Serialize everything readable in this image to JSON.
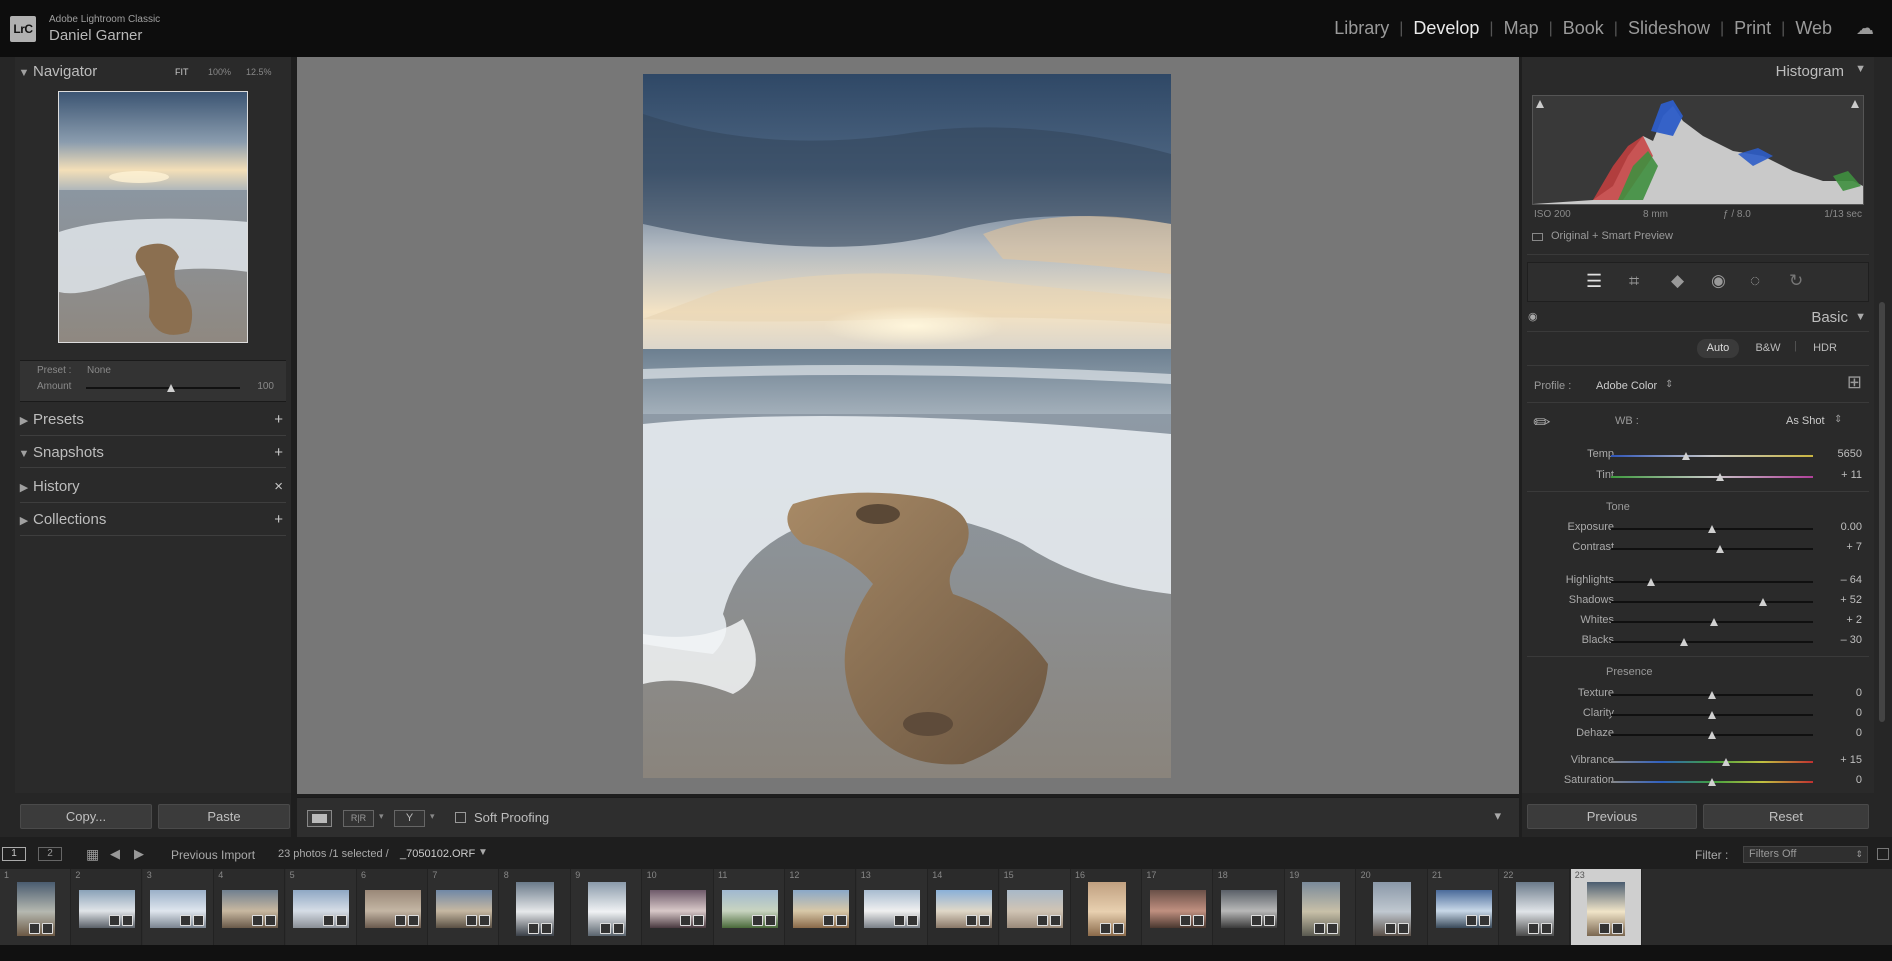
{
  "app": {
    "subtitle": "Adobe Lightroom Classic",
    "user": "Daniel Garner",
    "logo": "LrC"
  },
  "modules": [
    {
      "label": "Library",
      "active": false
    },
    {
      "label": "Develop",
      "active": true
    },
    {
      "label": "Map",
      "active": false
    },
    {
      "label": "Book",
      "active": false
    },
    {
      "label": "Slideshow",
      "active": false
    },
    {
      "label": "Print",
      "active": false
    },
    {
      "label": "Web",
      "active": false
    }
  ],
  "left": {
    "navigator": {
      "title": "Navigator",
      "fit": "FIT",
      "z100": "100%",
      "z125": "12.5%"
    },
    "preset": {
      "label": "Preset :",
      "value": "None",
      "amount_label": "Amount",
      "amount_value": "100",
      "amount_level": 0.55
    },
    "panels": [
      {
        "title": "Presets",
        "icon": "+"
      },
      {
        "title": "Snapshots",
        "icon": "+"
      },
      {
        "title": "History",
        "icon": "×"
      },
      {
        "title": "Collections",
        "icon": "+"
      }
    ],
    "copy": "Copy...",
    "paste": "Paste"
  },
  "toolbar": {
    "soft_proofing": "Soft Proofing"
  },
  "right": {
    "histogram": {
      "title": "Histogram",
      "iso": "ISO 200",
      "focal": "8 mm",
      "aperture": "ƒ / 8.0",
      "shutter": "1/13 sec",
      "preview": "Original + Smart Preview"
    },
    "basic": {
      "title": "Basic",
      "auto": "Auto",
      "bw": "B&W",
      "hdr": "HDR",
      "profile_label": "Profile :",
      "profile_value": "Adobe Color",
      "wb_label": "WB :",
      "wb_value": "As Shot",
      "tone": "Tone",
      "presence": "Presence"
    },
    "sliders": [
      {
        "label": "Temp",
        "value": "5650",
        "level": 0.37,
        "kind": "temp"
      },
      {
        "label": "Tint",
        "value": "+ 11",
        "level": 0.54,
        "kind": "tint"
      },
      {
        "label": "Exposure",
        "value": "0.00",
        "level": 0.5,
        "kind": "plain"
      },
      {
        "label": "Contrast",
        "value": "+ 7",
        "level": 0.54,
        "kind": "plain"
      },
      {
        "label": "Highlights",
        "value": "– 64",
        "level": 0.2,
        "kind": "plain"
      },
      {
        "label": "Shadows",
        "value": "+ 52",
        "level": 0.75,
        "kind": "plain"
      },
      {
        "label": "Whites",
        "value": "+ 2",
        "level": 0.51,
        "kind": "plain"
      },
      {
        "label": "Blacks",
        "value": "– 30",
        "level": 0.36,
        "kind": "plain"
      },
      {
        "label": "Texture",
        "value": "0",
        "level": 0.5,
        "kind": "plain"
      },
      {
        "label": "Clarity",
        "value": "0",
        "level": 0.5,
        "kind": "plain"
      },
      {
        "label": "Dehaze",
        "value": "0",
        "level": 0.5,
        "kind": "plain"
      },
      {
        "label": "Vibrance",
        "value": "+ 15",
        "level": 0.57,
        "kind": "vib"
      },
      {
        "label": "Saturation",
        "value": "0",
        "level": 0.5,
        "kind": "vib"
      }
    ],
    "previous": "Previous",
    "reset": "Reset"
  },
  "filmbar": {
    "screen1": "1",
    "screen2": "2",
    "source": "Previous Import",
    "count": "23 photos /1 selected /",
    "filename": "_7050102.ORF",
    "filter_label": "Filter :",
    "filter_value": "Filters Off"
  },
  "thumbs": [
    "1",
    "2",
    "3",
    "4",
    "5",
    "6",
    "7",
    "8",
    "9",
    "10",
    "11",
    "12",
    "13",
    "14",
    "15",
    "16",
    "17",
    "18",
    "19",
    "20",
    "21",
    "22",
    "23"
  ]
}
